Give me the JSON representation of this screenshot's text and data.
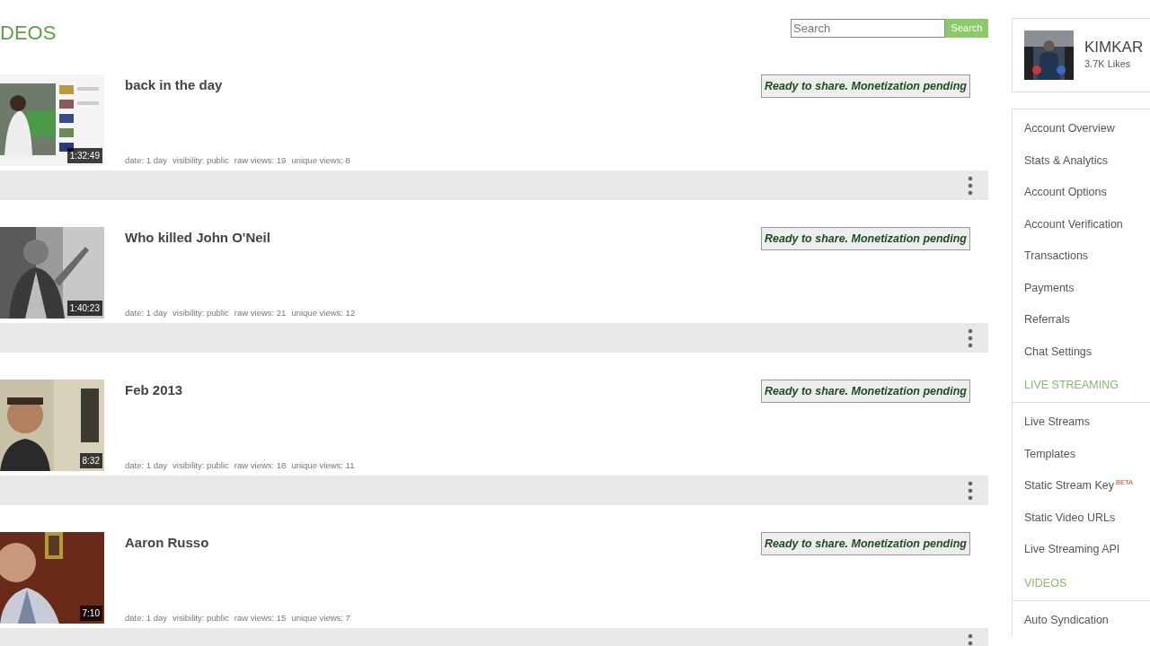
{
  "page_title": "DEOS",
  "search": {
    "placeholder": "Search",
    "button": "Search"
  },
  "videos": [
    {
      "title": "back in the day",
      "duration": "1:32:49",
      "date": "date: 1 day",
      "visibility": "visibility: public",
      "raw_views": "raw views: 19",
      "unique_views": "unique views: 8",
      "status": "Ready to share. Monetization pending"
    },
    {
      "title": "Who killed John O'Neil",
      "duration": "1:40:23",
      "date": "date: 1 day",
      "visibility": "visibility: public",
      "raw_views": "raw views: 21",
      "unique_views": "unique views: 12",
      "status": "Ready to share. Monetization pending"
    },
    {
      "title": "Feb 2013",
      "duration": "8:32",
      "date": "date: 1 day",
      "visibility": "visibility: public",
      "raw_views": "raw views: 18",
      "unique_views": "unique views: 11",
      "status": "Ready to share. Monetization pending"
    },
    {
      "title": "Aaron Russo",
      "duration": "7:10",
      "date": "date: 1 day",
      "visibility": "visibility: public",
      "raw_views": "raw views: 15",
      "unique_views": "unique views: 7",
      "status": "Ready to share. Monetization pending"
    }
  ],
  "profile": {
    "name": "KIMKAR",
    "likes": "3.7K Likes"
  },
  "menu": [
    {
      "kind": "link",
      "label": "Account Overview"
    },
    {
      "kind": "link",
      "label": "Stats & Analytics"
    },
    {
      "kind": "link",
      "label": "Account Options"
    },
    {
      "kind": "link",
      "label": "Account Verification"
    },
    {
      "kind": "link",
      "label": "Transactions"
    },
    {
      "kind": "link",
      "label": "Payments"
    },
    {
      "kind": "link",
      "label": "Referrals"
    },
    {
      "kind": "link",
      "label": "Chat Settings"
    },
    {
      "kind": "header",
      "label": "LIVE STREAMING"
    },
    {
      "kind": "link",
      "label": "Live Streams"
    },
    {
      "kind": "link",
      "label": "Templates"
    },
    {
      "kind": "link",
      "label": "Static Stream Key",
      "badge": "BETA"
    },
    {
      "kind": "link",
      "label": "Static Video URLs"
    },
    {
      "kind": "link",
      "label": "Live Streaming API"
    },
    {
      "kind": "header",
      "label": "VIDEOS"
    },
    {
      "kind": "link",
      "label": "Auto Syndication"
    }
  ]
}
